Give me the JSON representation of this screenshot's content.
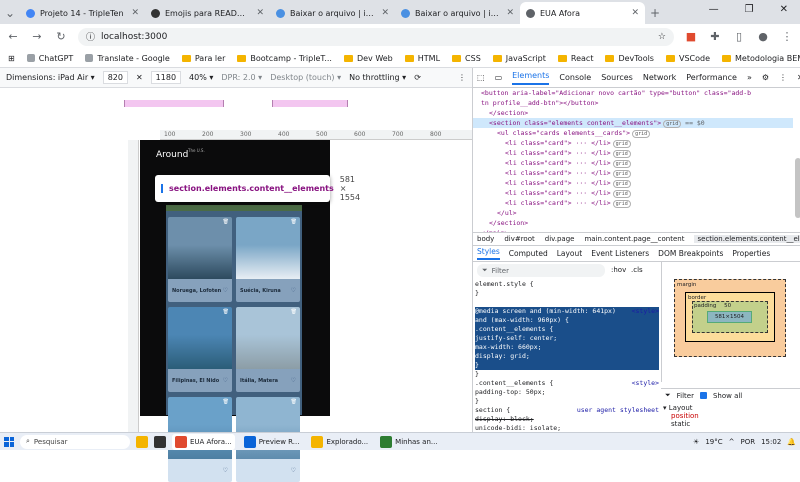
{
  "browser": {
    "tabs": [
      {
        "title": "Projeto 14 - TripleTen",
        "color": "#4285f4"
      },
      {
        "title": "Emojis para README.md",
        "color": "#333333"
      },
      {
        "title": "Baixar o arquivo | iLoveIMG",
        "color": "#4a90e2"
      },
      {
        "title": "Baixar o arquivo | iLoveIMG",
        "color": "#4a90e2"
      },
      {
        "title": "EUA Afora",
        "color": "#5f6368"
      }
    ],
    "url": "localhost:3000",
    "bookmarks": [
      "ChatGPT",
      "Translate - Google",
      "Para ler",
      "Bootcamp - TripleT...",
      "Dev Web",
      "HTML",
      "CSS",
      "JavaScript",
      "React",
      "DevTools",
      "VSCode",
      "Metodologia BEM"
    ]
  },
  "device_toolbar": {
    "dimensions_label": "Dimensions: iPad Air",
    "width": "820",
    "height": "1180",
    "zoom": "40%",
    "dpr": "DPR: 2.0",
    "mode": "Desktop (touch)",
    "throttle": "No throttling"
  },
  "ruler_labels": [
    "100",
    "200",
    "300",
    "400",
    "500",
    "600",
    "700",
    "800"
  ],
  "page": {
    "title": "Around",
    "title_sup": "The U.S.",
    "cards": [
      {
        "name": "Noruega, Lofoten",
        "sky": "#6d8fab",
        "land": "#2d4a5e"
      },
      {
        "name": "Suécia, Kiruna",
        "sky": "#7aa6c6",
        "land": "#e8eef4"
      },
      {
        "name": "Filipinas, El Nido",
        "sky": "#4c86b4",
        "land": "#2b5d78"
      },
      {
        "name": "Itália, Matera",
        "sky": "#a9c4d8",
        "land": "#8c9da6"
      },
      {
        "name": "",
        "sky": "#6aa1c9",
        "land": "#4d7fa2"
      },
      {
        "name": "",
        "sky": "#8fb5d1",
        "land": "#5f8cae"
      }
    ]
  },
  "inspect_tooltip": {
    "selector": "section.elements.content__elements",
    "size": "581 × 1554"
  },
  "devtools": {
    "tabs": [
      "Elements",
      "Console",
      "Sources",
      "Network",
      "Performance"
    ],
    "dom_lines": [
      {
        "indent": 0,
        "html": "<button aria-label=\"Adicionar novo cartão\" type=\"button\" class=\"add-b"
      },
      {
        "indent": 0,
        "html": "tn profile__add-btn\"></button>"
      },
      {
        "indent": 1,
        "html": "</section>"
      },
      {
        "indent": 1,
        "html": "<section class=\"elements content__elements\">",
        "badge": "grid",
        "suffix": "== $0",
        "selected": true
      },
      {
        "indent": 2,
        "html": "<ul class=\"cards elements__cards\">",
        "badge": "grid"
      },
      {
        "indent": 3,
        "html": "<li class=\"card\"> ··· </li>",
        "badge": "grid"
      },
      {
        "indent": 3,
        "html": "<li class=\"card\"> ··· </li>",
        "badge": "grid"
      },
      {
        "indent": 3,
        "html": "<li class=\"card\"> ··· </li>",
        "badge": "grid"
      },
      {
        "indent": 3,
        "html": "<li class=\"card\"> ··· </li>",
        "badge": "grid"
      },
      {
        "indent": 3,
        "html": "<li class=\"card\"> ··· </li>",
        "badge": "grid"
      },
      {
        "indent": 3,
        "html": "<li class=\"card\"> ··· </li>",
        "badge": "grid"
      },
      {
        "indent": 3,
        "html": "<li class=\"card\"> ··· </li>",
        "badge": "grid"
      },
      {
        "indent": 2,
        "html": "</ul>"
      },
      {
        "indent": 1,
        "html": "</section>"
      },
      {
        "indent": 0,
        "html": "</main>"
      }
    ],
    "breadcrumbs": [
      "body",
      "div#root",
      "div.page",
      "main.content.page__content",
      "section.elements.content__elements"
    ],
    "subtabs": [
      "Styles",
      "Computed",
      "Layout",
      "Event Listeners",
      "DOM Breakpoints",
      "Properties"
    ],
    "filter_placeholder": "Filter",
    "hov": ":hov",
    "cls": ".cls",
    "style_lines": [
      {
        "text": "element.style {",
        "hl": false
      },
      {
        "text": "}",
        "hl": false
      },
      {
        "text": "",
        "hl": false
      },
      {
        "text": "@media screen and (min-width: 641px)",
        "hl": true,
        "src": "<style>"
      },
      {
        "text": "and (max-width: 960px) {",
        "hl": true
      },
      {
        "text": ".content__elements {",
        "hl": true
      },
      {
        "text": "    justify-self: center;",
        "hl": true
      },
      {
        "text": "    max-width: 660px;",
        "hl": true
      },
      {
        "text": "    display: grid;",
        "hl": true
      },
      {
        "text": "}",
        "hl": true
      },
      {
        "text": "}",
        "hl": false
      },
      {
        "text": ".content__elements {",
        "hl": false,
        "src": "<style>"
      },
      {
        "text": "    padding-top: 50px;",
        "hl": false
      },
      {
        "text": "}",
        "hl": false
      },
      {
        "text": "section {",
        "hl": false,
        "src": "user agent stylesheet"
      },
      {
        "text": "    display: block;",
        "hl": false,
        "strike": true
      },
      {
        "text": "    unicode-bidi: isolate;",
        "hl": false
      }
    ],
    "boxmodel": {
      "margin_label": "margin",
      "border_label": "border",
      "padding_label": "padding",
      "padding_top": "50",
      "content": "581×1504",
      "dash": "-"
    },
    "bm_filter": "Filter",
    "show_all": "Show all",
    "layout_section": "Layout",
    "layout_props": [
      "position",
      "static"
    ]
  },
  "taskbar": {
    "search": "Pesquisar",
    "tasks": [
      {
        "label": "EUA Afora...",
        "color": "#e04a2f",
        "active": true
      },
      {
        "label": "Preview R...",
        "color": "#0a64d8",
        "active": false
      },
      {
        "label": "Explorado...",
        "color": "#f4b400",
        "active": false
      },
      {
        "label": "Minhas an...",
        "color": "#2e7d32",
        "active": false
      }
    ],
    "weather": "19°C",
    "lang": "POR",
    "time": "15:02"
  }
}
